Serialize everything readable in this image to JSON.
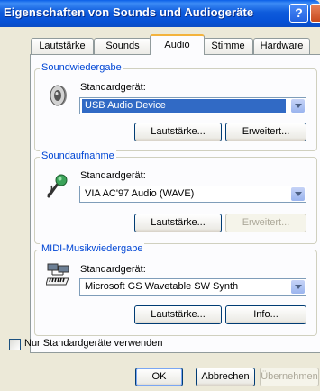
{
  "window": {
    "title": "Eigenschaften von Sounds und Audiogeräte",
    "help_glyph": "?"
  },
  "tabs": [
    {
      "label": "Lautstärke"
    },
    {
      "label": "Sounds"
    },
    {
      "label": "Audio",
      "active": true
    },
    {
      "label": "Stimme"
    },
    {
      "label": "Hardware"
    }
  ],
  "playback": {
    "legend": "Soundwiedergabe",
    "field_label": "Standardgerät:",
    "device": "USB Audio Device",
    "volume_button": "Lautstärke...",
    "advanced_button": "Erweitert...",
    "icon": "speaker-icon"
  },
  "recording": {
    "legend": "Soundaufnahme",
    "field_label": "Standardgerät:",
    "device": "VIA AC'97 Audio (WAVE)",
    "volume_button": "Lautstärke...",
    "advanced_button": "Erweitert...",
    "icon": "microphone-icon"
  },
  "midi": {
    "legend": "MIDI-Musikwiedergabe",
    "field_label": "Standardgerät:",
    "device": "Microsoft GS Wavetable SW Synth",
    "volume_button": "Lautstärke...",
    "info_button": "Info...",
    "icon": "midi-keyboard-icon"
  },
  "only_default_checkbox": {
    "label": "Nur Standardgeräte verwenden",
    "checked": false
  },
  "footer": {
    "ok": "OK",
    "cancel": "Abbrechen",
    "apply": "Übernehmen"
  },
  "colors": {
    "title_bar": "#0A5FE8",
    "group_label": "#0046D5",
    "selection": "#316AC5",
    "active_tab_accent": "#F3B33D"
  }
}
